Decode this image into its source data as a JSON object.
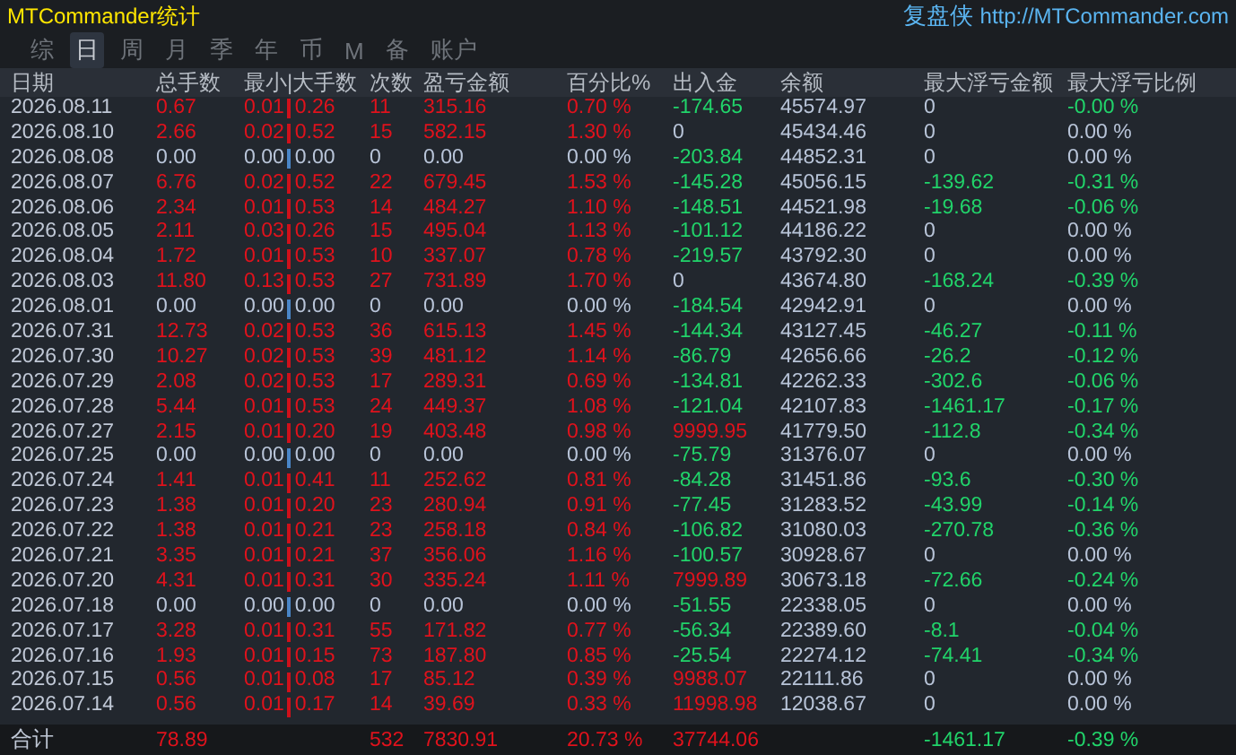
{
  "title": "MTCommander统计",
  "brand": "复盘侠",
  "website": "http://MTCommander.com",
  "tabs": [
    {
      "label": "综",
      "selected": false
    },
    {
      "label": "日",
      "selected": true
    },
    {
      "label": "周",
      "selected": false
    },
    {
      "label": "月",
      "selected": false
    },
    {
      "label": "季",
      "selected": false
    },
    {
      "label": "年",
      "selected": false
    },
    {
      "label": "币",
      "selected": false
    },
    {
      "label": "M",
      "selected": false
    },
    {
      "label": "备",
      "selected": false
    },
    {
      "label": "账户",
      "selected": false
    }
  ],
  "columns": [
    "日期",
    "总手数",
    "最小|大手数",
    "次数",
    "盈亏金额",
    "百分比%",
    "出入金",
    "余额",
    "最大浮亏金额",
    "最大浮亏比例"
  ],
  "rows": [
    {
      "date": "2026.08.11",
      "lots": "0.67",
      "min": "0.01",
      "max": "0.26",
      "trades": "11",
      "profit": "315.16",
      "pct": "0.70 %",
      "traded": true,
      "balance": "45574.97",
      "cash": {
        "text": "-174.65",
        "color": "#21d46a"
      },
      "dd": {
        "text": "0",
        "color": "#b8c4d8"
      },
      "dd_pct": {
        "text": "-0.00 %",
        "color": "#21d46a"
      }
    },
    {
      "date": "2026.08.10",
      "lots": "2.66",
      "min": "0.02",
      "max": "0.52",
      "trades": "15",
      "profit": "582.15",
      "pct": "1.30 %",
      "traded": true,
      "balance": "45434.46",
      "cash": {
        "text": "0",
        "color": "#b8c4d8"
      },
      "dd": {
        "text": "0",
        "color": "#b8c4d8"
      },
      "dd_pct": {
        "text": "0.00 %",
        "color": "#b8c4d8"
      }
    },
    {
      "date": "2026.08.08",
      "lots": "0.00",
      "min": "0.00",
      "max": "0.00",
      "trades": "0",
      "profit": "0.00",
      "pct": "0.00 %",
      "traded": false,
      "balance": "44852.31",
      "cash": {
        "text": "-203.84",
        "color": "#21d46a"
      },
      "dd": {
        "text": "0",
        "color": "#b8c4d8"
      },
      "dd_pct": {
        "text": "0.00 %",
        "color": "#b8c4d8"
      }
    },
    {
      "date": "2026.08.07",
      "lots": "6.76",
      "min": "0.02",
      "max": "0.52",
      "trades": "22",
      "profit": "679.45",
      "pct": "1.53 %",
      "traded": true,
      "balance": "45056.15",
      "cash": {
        "text": "-145.28",
        "color": "#21d46a"
      },
      "dd": {
        "text": "-139.62",
        "color": "#21d46a"
      },
      "dd_pct": {
        "text": "-0.31 %",
        "color": "#21d46a"
      }
    },
    {
      "date": "2026.08.06",
      "lots": "2.34",
      "min": "0.01",
      "max": "0.53",
      "trades": "14",
      "profit": "484.27",
      "pct": "1.10 %",
      "traded": true,
      "balance": "44521.98",
      "cash": {
        "text": "-148.51",
        "color": "#21d46a"
      },
      "dd": {
        "text": "-19.68",
        "color": "#21d46a"
      },
      "dd_pct": {
        "text": "-0.06 %",
        "color": "#21d46a"
      }
    },
    {
      "date": "2026.08.05",
      "lots": "2.11",
      "min": "0.03",
      "max": "0.26",
      "trades": "15",
      "profit": "495.04",
      "pct": "1.13 %",
      "traded": true,
      "balance": "44186.22",
      "cash": {
        "text": "-101.12",
        "color": "#21d46a"
      },
      "dd": {
        "text": "0",
        "color": "#b8c4d8"
      },
      "dd_pct": {
        "text": "0.00 %",
        "color": "#b8c4d8"
      }
    },
    {
      "date": "2026.08.04",
      "lots": "1.72",
      "min": "0.01",
      "max": "0.53",
      "trades": "10",
      "profit": "337.07",
      "pct": "0.78 %",
      "traded": true,
      "balance": "43792.30",
      "cash": {
        "text": "-219.57",
        "color": "#21d46a"
      },
      "dd": {
        "text": "0",
        "color": "#b8c4d8"
      },
      "dd_pct": {
        "text": "0.00 %",
        "color": "#b8c4d8"
      }
    },
    {
      "date": "2026.08.03",
      "lots": "11.80",
      "min": "0.13",
      "max": "0.53",
      "trades": "27",
      "profit": "731.89",
      "pct": "1.70 %",
      "traded": true,
      "balance": "43674.80",
      "cash": {
        "text": "0",
        "color": "#b8c4d8"
      },
      "dd": {
        "text": "-168.24",
        "color": "#21d46a"
      },
      "dd_pct": {
        "text": "-0.39 %",
        "color": "#21d46a"
      }
    },
    {
      "date": "2026.08.01",
      "lots": "0.00",
      "min": "0.00",
      "max": "0.00",
      "trades": "0",
      "profit": "0.00",
      "pct": "0.00 %",
      "traded": false,
      "balance": "42942.91",
      "cash": {
        "text": "-184.54",
        "color": "#21d46a"
      },
      "dd": {
        "text": "0",
        "color": "#b8c4d8"
      },
      "dd_pct": {
        "text": "0.00 %",
        "color": "#b8c4d8"
      }
    },
    {
      "date": "2026.07.31",
      "lots": "12.73",
      "min": "0.02",
      "max": "0.53",
      "trades": "36",
      "profit": "615.13",
      "pct": "1.45 %",
      "traded": true,
      "balance": "43127.45",
      "cash": {
        "text": "-144.34",
        "color": "#21d46a"
      },
      "dd": {
        "text": "-46.27",
        "color": "#21d46a"
      },
      "dd_pct": {
        "text": "-0.11 %",
        "color": "#21d46a"
      }
    },
    {
      "date": "2026.07.30",
      "lots": "10.27",
      "min": "0.02",
      "max": "0.53",
      "trades": "39",
      "profit": "481.12",
      "pct": "1.14 %",
      "traded": true,
      "balance": "42656.66",
      "cash": {
        "text": "-86.79",
        "color": "#21d46a"
      },
      "dd": {
        "text": "-26.2",
        "color": "#21d46a"
      },
      "dd_pct": {
        "text": "-0.12 %",
        "color": "#21d46a"
      }
    },
    {
      "date": "2026.07.29",
      "lots": "2.08",
      "min": "0.02",
      "max": "0.53",
      "trades": "17",
      "profit": "289.31",
      "pct": "0.69 %",
      "traded": true,
      "balance": "42262.33",
      "cash": {
        "text": "-134.81",
        "color": "#21d46a"
      },
      "dd": {
        "text": "-302.6",
        "color": "#21d46a"
      },
      "dd_pct": {
        "text": "-0.06 %",
        "color": "#21d46a"
      }
    },
    {
      "date": "2026.07.28",
      "lots": "5.44",
      "min": "0.01",
      "max": "0.53",
      "trades": "24",
      "profit": "449.37",
      "pct": "1.08 %",
      "traded": true,
      "balance": "42107.83",
      "cash": {
        "text": "-121.04",
        "color": "#21d46a"
      },
      "dd": {
        "text": "-1461.17",
        "color": "#21d46a"
      },
      "dd_pct": {
        "text": "-0.17 %",
        "color": "#21d46a"
      }
    },
    {
      "date": "2026.07.27",
      "lots": "2.15",
      "min": "0.01",
      "max": "0.20",
      "trades": "19",
      "profit": "403.48",
      "pct": "0.98 %",
      "traded": true,
      "balance": "41779.50",
      "cash": {
        "text": "9999.95",
        "color": "#e0121c"
      },
      "dd": {
        "text": "-112.8",
        "color": "#21d46a"
      },
      "dd_pct": {
        "text": "-0.34 %",
        "color": "#21d46a"
      }
    },
    {
      "date": "2026.07.25",
      "lots": "0.00",
      "min": "0.00",
      "max": "0.00",
      "trades": "0",
      "profit": "0.00",
      "pct": "0.00 %",
      "traded": false,
      "balance": "31376.07",
      "cash": {
        "text": "-75.79",
        "color": "#21d46a"
      },
      "dd": {
        "text": "0",
        "color": "#b8c4d8"
      },
      "dd_pct": {
        "text": "0.00 %",
        "color": "#b8c4d8"
      }
    },
    {
      "date": "2026.07.24",
      "lots": "1.41",
      "min": "0.01",
      "max": "0.41",
      "trades": "11",
      "profit": "252.62",
      "pct": "0.81 %",
      "traded": true,
      "balance": "31451.86",
      "cash": {
        "text": "-84.28",
        "color": "#21d46a"
      },
      "dd": {
        "text": "-93.6",
        "color": "#21d46a"
      },
      "dd_pct": {
        "text": "-0.30 %",
        "color": "#21d46a"
      }
    },
    {
      "date": "2026.07.23",
      "lots": "1.38",
      "min": "0.01",
      "max": "0.20",
      "trades": "23",
      "profit": "280.94",
      "pct": "0.91 %",
      "traded": true,
      "balance": "31283.52",
      "cash": {
        "text": "-77.45",
        "color": "#21d46a"
      },
      "dd": {
        "text": "-43.99",
        "color": "#21d46a"
      },
      "dd_pct": {
        "text": "-0.14 %",
        "color": "#21d46a"
      }
    },
    {
      "date": "2026.07.22",
      "lots": "1.38",
      "min": "0.01",
      "max": "0.21",
      "trades": "23",
      "profit": "258.18",
      "pct": "0.84 %",
      "traded": true,
      "balance": "31080.03",
      "cash": {
        "text": "-106.82",
        "color": "#21d46a"
      },
      "dd": {
        "text": "-270.78",
        "color": "#21d46a"
      },
      "dd_pct": {
        "text": "-0.36 %",
        "color": "#21d46a"
      }
    },
    {
      "date": "2026.07.21",
      "lots": "3.35",
      "min": "0.01",
      "max": "0.21",
      "trades": "37",
      "profit": "356.06",
      "pct": "1.16 %",
      "traded": true,
      "balance": "30928.67",
      "cash": {
        "text": "-100.57",
        "color": "#21d46a"
      },
      "dd": {
        "text": "0",
        "color": "#b8c4d8"
      },
      "dd_pct": {
        "text": "0.00 %",
        "color": "#b8c4d8"
      }
    },
    {
      "date": "2026.07.20",
      "lots": "4.31",
      "min": "0.01",
      "max": "0.31",
      "trades": "30",
      "profit": "335.24",
      "pct": "1.11 %",
      "traded": true,
      "balance": "30673.18",
      "cash": {
        "text": "7999.89",
        "color": "#e0121c"
      },
      "dd": {
        "text": "-72.66",
        "color": "#21d46a"
      },
      "dd_pct": {
        "text": "-0.24 %",
        "color": "#21d46a"
      }
    },
    {
      "date": "2026.07.18",
      "lots": "0.00",
      "min": "0.00",
      "max": "0.00",
      "trades": "0",
      "profit": "0.00",
      "pct": "0.00 %",
      "traded": false,
      "balance": "22338.05",
      "cash": {
        "text": "-51.55",
        "color": "#21d46a"
      },
      "dd": {
        "text": "0",
        "color": "#b8c4d8"
      },
      "dd_pct": {
        "text": "0.00 %",
        "color": "#b8c4d8"
      }
    },
    {
      "date": "2026.07.17",
      "lots": "3.28",
      "min": "0.01",
      "max": "0.31",
      "trades": "55",
      "profit": "171.82",
      "pct": "0.77 %",
      "traded": true,
      "balance": "22389.60",
      "cash": {
        "text": "-56.34",
        "color": "#21d46a"
      },
      "dd": {
        "text": "-8.1",
        "color": "#21d46a"
      },
      "dd_pct": {
        "text": "-0.04 %",
        "color": "#21d46a"
      }
    },
    {
      "date": "2026.07.16",
      "lots": "1.93",
      "min": "0.01",
      "max": "0.15",
      "trades": "73",
      "profit": "187.80",
      "pct": "0.85 %",
      "traded": true,
      "balance": "22274.12",
      "cash": {
        "text": "-25.54",
        "color": "#21d46a"
      },
      "dd": {
        "text": "-74.41",
        "color": "#21d46a"
      },
      "dd_pct": {
        "text": "-0.34 %",
        "color": "#21d46a"
      }
    },
    {
      "date": "2026.07.15",
      "lots": "0.56",
      "min": "0.01",
      "max": "0.08",
      "trades": "17",
      "profit": "85.12",
      "pct": "0.39 %",
      "traded": true,
      "balance": "22111.86",
      "cash": {
        "text": "9988.07",
        "color": "#e0121c"
      },
      "dd": {
        "text": "0",
        "color": "#b8c4d8"
      },
      "dd_pct": {
        "text": "0.00 %",
        "color": "#b8c4d8"
      }
    },
    {
      "date": "2026.07.14",
      "lots": "0.56",
      "min": "0.01",
      "max": "0.17",
      "trades": "14",
      "profit": "39.69",
      "pct": "0.33 %",
      "traded": true,
      "balance": "12038.67",
      "cash": {
        "text": "11998.98",
        "color": "#e0121c"
      },
      "dd": {
        "text": "0",
        "color": "#b8c4d8"
      },
      "dd_pct": {
        "text": "0.00 %",
        "color": "#b8c4d8"
      }
    }
  ],
  "total": {
    "label": "合计",
    "lots": "78.89",
    "trades": "532",
    "profit": "7830.91",
    "pct": "20.73 %",
    "cash": "37744.06",
    "dd": "-1461.17",
    "dd_pct": "-0.39 %"
  }
}
